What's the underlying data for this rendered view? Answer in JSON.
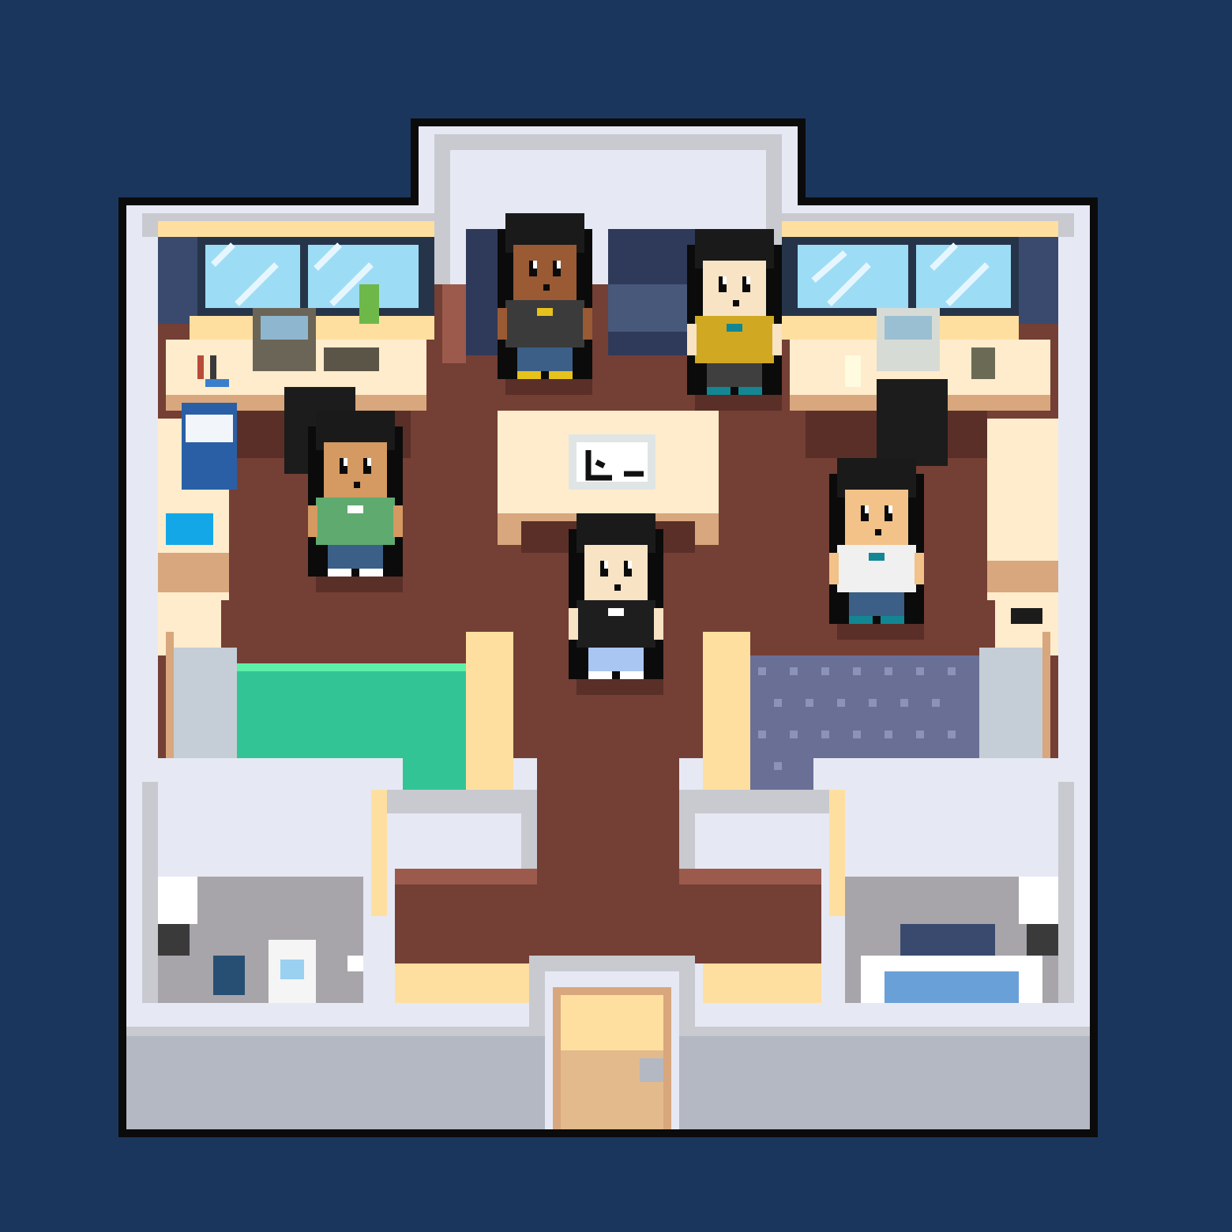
{
  "scene": {
    "kind": "pixel-art top-down apartment",
    "palette": {
      "backdrop": "#1b365d",
      "outline": "#0b0b0b",
      "wall": "#e6e9f4",
      "wall_shadow": "#c8cad0",
      "floor_wood": "#743f35",
      "floor_wood_edge": "#9b5a4c",
      "desk_top": "#ffeccc",
      "desk_edge": "#d8a77d",
      "window_glass": "#9ddcf5",
      "curtain": "#3a4a6e",
      "rug_green": "#33c496",
      "rug_blue": "#6a6f96",
      "bathroom_tile": "#a7a5aa",
      "door": "#e2ba8b"
    }
  },
  "characters": [
    {
      "id": "char-1",
      "hair": "#1a1a1a",
      "skin": "#9a5a34",
      "shirt": "#3b3b3b",
      "pants": "#3b5f86",
      "accent": "#e6c21c"
    },
    {
      "id": "char-2",
      "hair": "#1a1a1a",
      "skin": "#f9e3c5",
      "shirt": "#d1a822",
      "pants": "#3f3f3f",
      "accent": "#138693"
    },
    {
      "id": "char-3",
      "hair": "#1a1a1a",
      "skin": "#d49a62",
      "shirt": "#5faa6e",
      "pants": "#3b5f86",
      "accent": "#ffffff"
    },
    {
      "id": "char-4",
      "hair": "#1a1a1a",
      "skin": "#f9e3c5",
      "shirt": "#1e1e1e",
      "pants": "#a9c6f2",
      "accent": "#ffffff"
    },
    {
      "id": "char-5",
      "hair": "#1a1a1a",
      "skin": "#f2c288",
      "shirt": "#f0f0f0",
      "pants": "#3b5f86",
      "accent": "#138693"
    }
  ]
}
